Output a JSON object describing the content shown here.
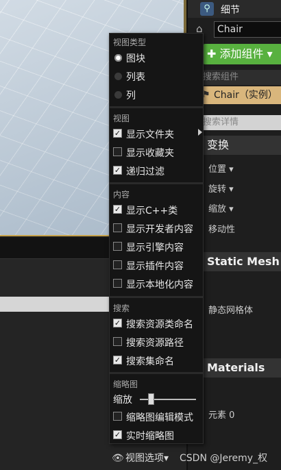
{
  "details": {
    "title": "细节",
    "name_value": "Chair",
    "add_component": "添加组件",
    "search_components_placeholder": "搜索组件",
    "instance_label": "Chair（实例）",
    "search_details_placeholder": "搜索详情",
    "sections": {
      "transform": "变换",
      "static_mesh": "Static Mesh",
      "materials": "Materials"
    },
    "props": {
      "location": "位置",
      "rotation": "旋转",
      "scale": "缩放",
      "mobility": "移动性",
      "static_mesh": "静态网格体",
      "element0": "元素 0"
    }
  },
  "menu": {
    "view_type_header": "视图类型",
    "view_types": [
      {
        "label": "图块",
        "selected": true
      },
      {
        "label": "列表",
        "selected": false
      },
      {
        "label": "列",
        "selected": false
      }
    ],
    "view_header": "视图",
    "view_items": [
      {
        "label": "显示文件夹",
        "checked": true
      },
      {
        "label": "显示收藏夹",
        "checked": false
      },
      {
        "label": "递归过滤",
        "checked": true
      }
    ],
    "content_header": "内容",
    "content_items": [
      {
        "label": "显示C++类",
        "checked": true
      },
      {
        "label": "显示开发者内容",
        "checked": false
      },
      {
        "label": "显示引擎内容",
        "checked": false
      },
      {
        "label": "显示插件内容",
        "checked": false
      },
      {
        "label": "显示本地化内容",
        "checked": false
      }
    ],
    "search_header": "搜索",
    "search_items": [
      {
        "label": "搜索资源类命名",
        "checked": true
      },
      {
        "label": "搜索资源路径",
        "checked": false
      },
      {
        "label": "搜索集命名",
        "checked": true
      }
    ],
    "thumbnail_header": "缩略图",
    "scale_label": "缩放",
    "scale_level": 0.2,
    "thumbnail_items": [
      {
        "label": "缩略图编辑模式",
        "checked": false
      },
      {
        "label": "实时缩略图",
        "checked": true
      }
    ]
  },
  "bottom": {
    "view_options": "视图选项",
    "watermark": "CSDN @Jeremy_权"
  }
}
